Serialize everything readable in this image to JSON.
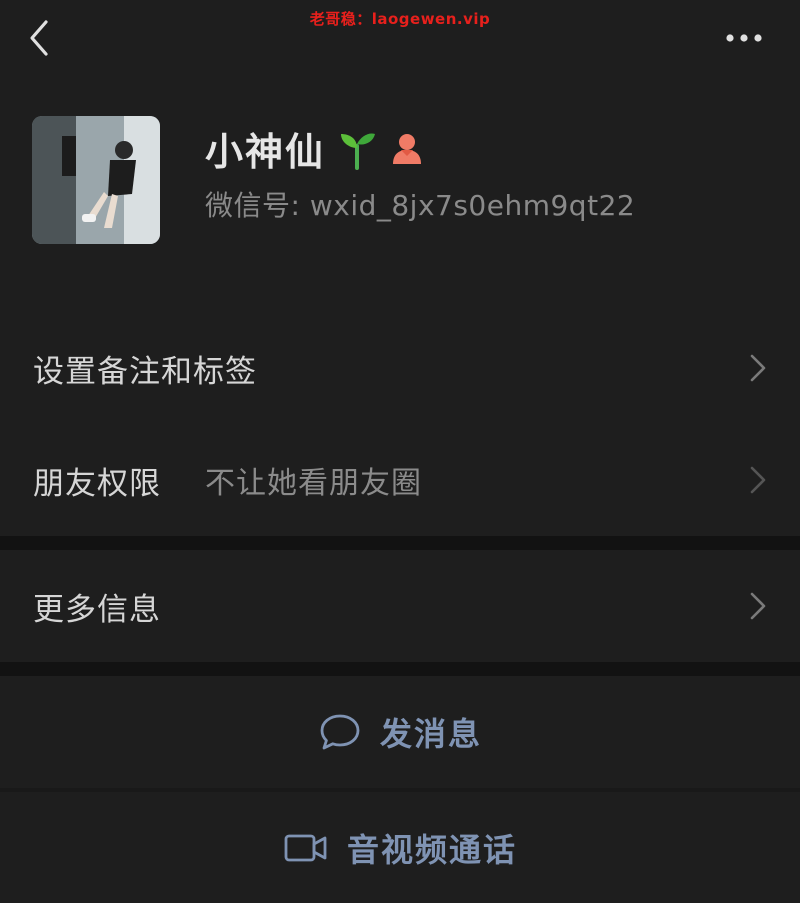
{
  "watermark": "老哥稳：laogewen.vip",
  "profile": {
    "nickname": "小神仙",
    "wxid_prefix": "微信号: ",
    "wxid": "wxid_8jx7s0ehm9qt22",
    "badges": [
      "seedling-icon",
      "female-person-icon"
    ]
  },
  "menu": [
    {
      "label": "设置备注和标签",
      "value": ""
    },
    {
      "label": "朋友权限",
      "value": "不让她看朋友圈"
    },
    {
      "label": "更多信息",
      "value": ""
    }
  ],
  "actions": {
    "message": {
      "label": "发消息",
      "icon": "chat-bubble-icon"
    },
    "video_call": {
      "label": "音视频通话",
      "icon": "video-camera-icon"
    }
  },
  "colors": {
    "background": "#191919",
    "surface": "#1e1e1e",
    "separator": "#121212",
    "action_blue": "#7f93b3",
    "watermark_red": "#e8201c"
  }
}
